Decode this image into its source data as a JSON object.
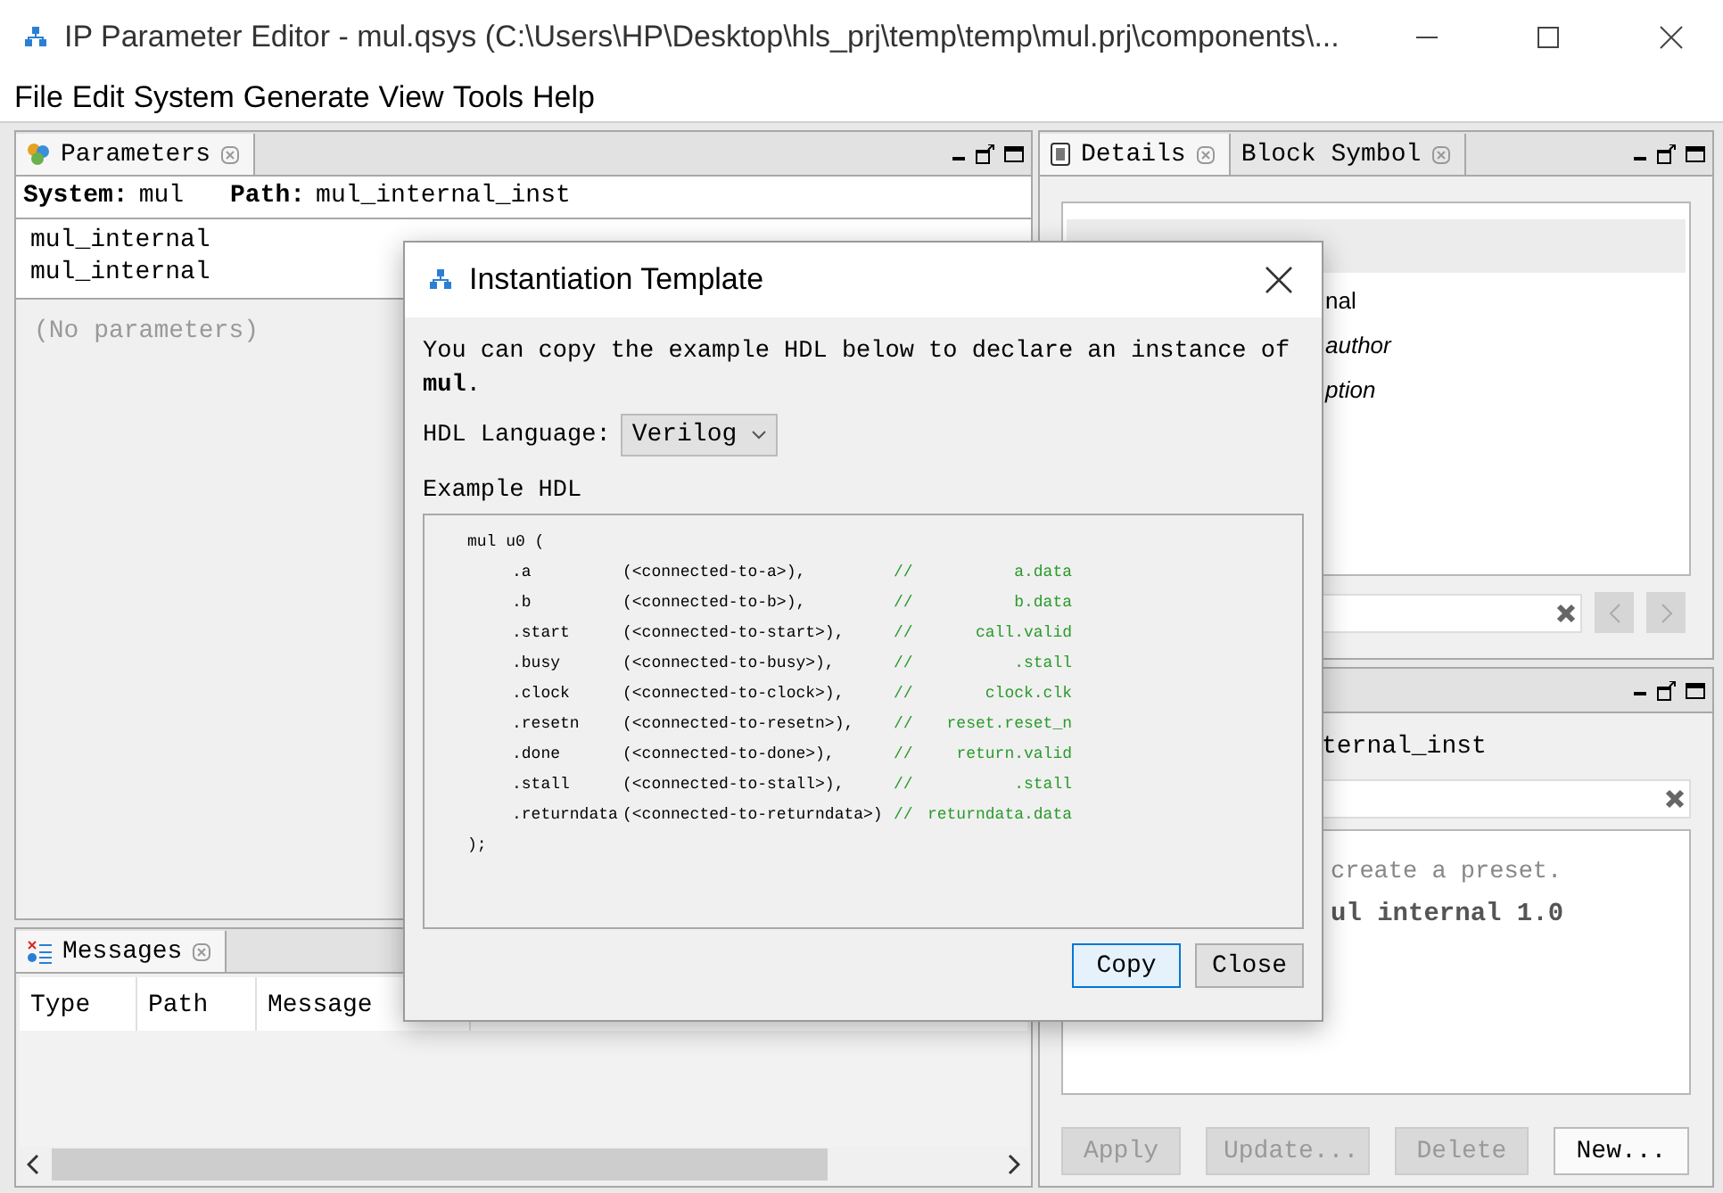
{
  "window": {
    "title": "IP Parameter Editor - mul.qsys (C:\\Users\\HP\\Desktop\\hls_prj\\temp\\temp\\mul.prj\\components\\..."
  },
  "menu": [
    "File",
    "Edit",
    "System",
    "Generate",
    "View",
    "Tools",
    "Help"
  ],
  "parameters_panel": {
    "tab": "Parameters",
    "system_label": "System:",
    "system": "mul",
    "path_label": "Path:",
    "path": "mul_internal_inst",
    "items": [
      "mul_internal",
      "mul_internal"
    ],
    "empty_text": "(No parameters)"
  },
  "messages_panel": {
    "tab": "Messages",
    "columns": [
      "Type",
      "Path",
      "Message"
    ]
  },
  "details_panel": {
    "tabs": [
      {
        "label": "Details",
        "selected": true
      },
      {
        "label": "Block Symbol",
        "selected": false
      }
    ],
    "fragments": [
      {
        "text": "nal",
        "italic": false
      },
      {
        "text": "author",
        "italic": true
      },
      {
        "text": "ption",
        "italic": true
      }
    ]
  },
  "presets_panel": {
    "path_fragment": "ternal_inst",
    "hint": "create a preset.",
    "preset": "ul internal 1.0",
    "buttons": [
      {
        "label": "Apply",
        "disabled": true
      },
      {
        "label": "Update...",
        "disabled": true
      },
      {
        "label": "Delete",
        "disabled": true
      },
      {
        "label": "New...",
        "disabled": false
      }
    ]
  },
  "dialog": {
    "title": "Instantiation Template",
    "intro": "You can copy the example HDL below to declare an instance of **mul**.",
    "language_label": "HDL Language:",
    "language": "Verilog",
    "example_label": "Example HDL",
    "code_header": "mul u0 (",
    "code_rows": [
      {
        "port": ".a",
        "connection": "(<connected-to-a>),",
        "slashes": "//",
        "target": "a.data"
      },
      {
        "port": ".b",
        "connection": "(<connected-to-b>),",
        "slashes": "//",
        "target": "b.data"
      },
      {
        "port": ".start",
        "connection": "(<connected-to-start>),",
        "slashes": "//",
        "target": "call.valid"
      },
      {
        "port": ".busy",
        "connection": "(<connected-to-busy>),",
        "slashes": "//",
        "target": ".stall"
      },
      {
        "port": ".clock",
        "connection": "(<connected-to-clock>),",
        "slashes": "//",
        "target": "clock.clk"
      },
      {
        "port": ".resetn",
        "connection": "(<connected-to-resetn>),",
        "slashes": "//",
        "target": "reset.reset_n"
      },
      {
        "port": ".done",
        "connection": "(<connected-to-done>),",
        "slashes": "//",
        "target": "return.valid"
      },
      {
        "port": ".stall",
        "connection": "(<connected-to-stall>),",
        "slashes": "//",
        "target": ".stall"
      },
      {
        "port": ".returndata",
        "connection": "(<connected-to-returndata>)",
        "slashes": "//",
        "target": "returndata.data"
      }
    ],
    "code_footer": ");",
    "buttons": [
      {
        "label": "Copy",
        "focused": true
      },
      {
        "label": "Close",
        "focused": false
      }
    ]
  }
}
